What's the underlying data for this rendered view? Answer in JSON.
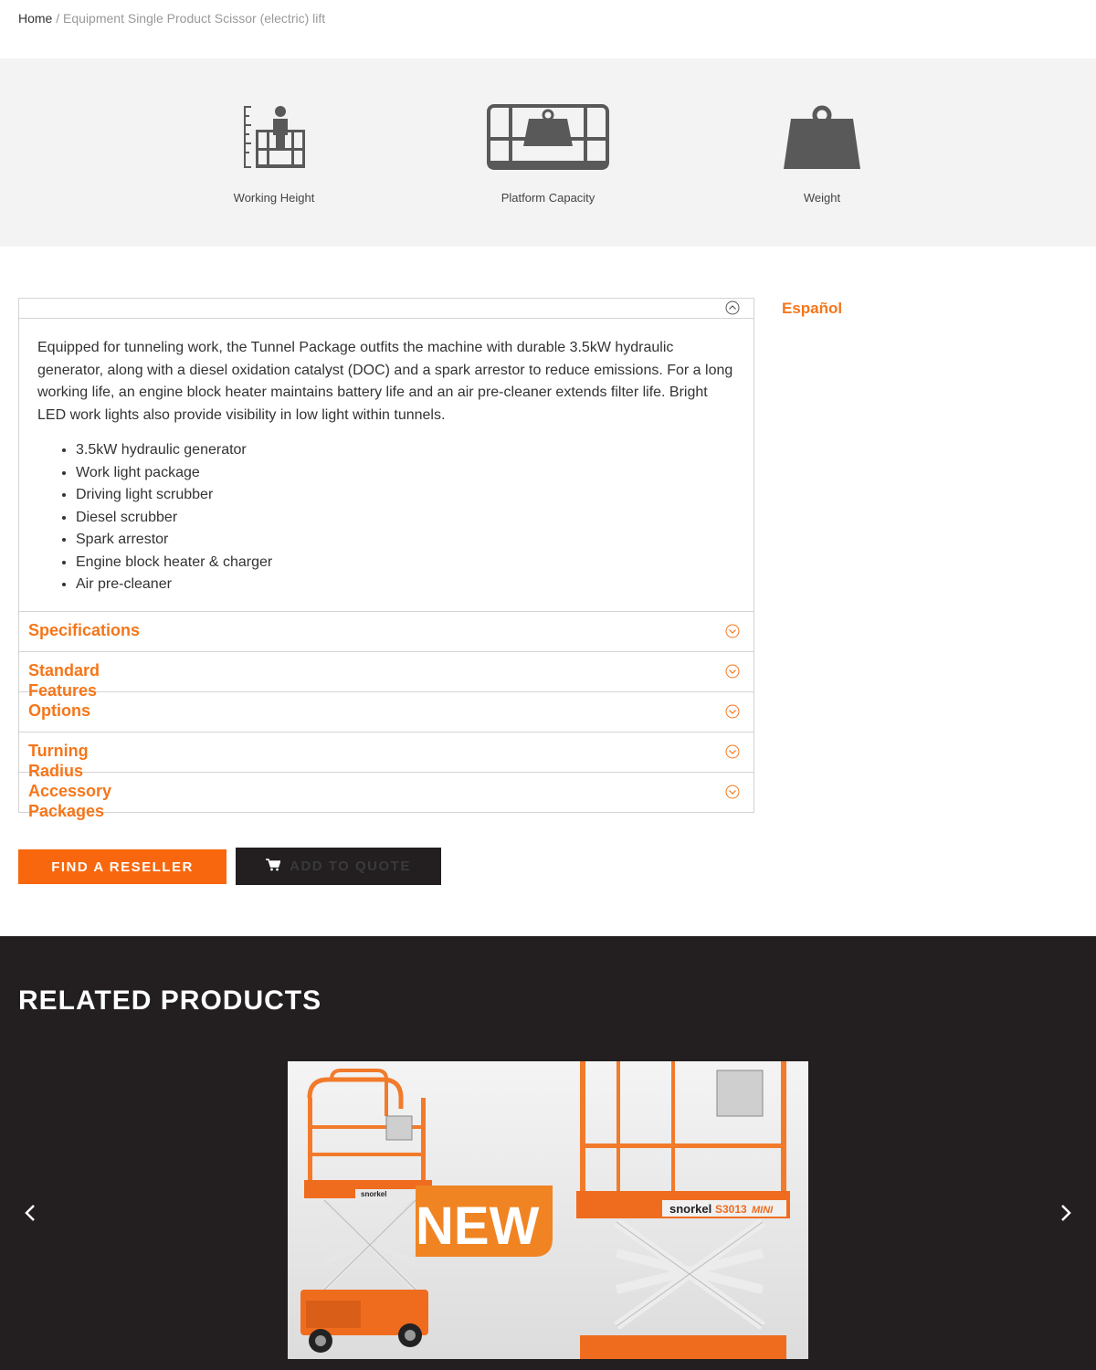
{
  "breadcrumb": {
    "home": "Home",
    "separator": "/",
    "trail": "Equipment Single Product Scissor (electric) lift"
  },
  "stats": [
    {
      "label": "Working Height",
      "icon": "working-height-icon"
    },
    {
      "label": "Platform Capacity",
      "icon": "platform-capacity-icon"
    },
    {
      "label": "Weight",
      "icon": "weight-icon"
    }
  ],
  "accordion": {
    "open_section": {
      "description": "Equipped for tunneling work, the Tunnel Package outfits the machine with durable 3.5kW hydraulic generator, along with a diesel oxidation catalyst (DOC) and a spark arrestor to reduce emissions. For a long working life, an engine block heater maintains battery life and an air pre-cleaner extends filter life. Bright LED work lights also provide visibility in low light within tunnels.",
      "features": [
        "3.5kW hydraulic generator",
        "Work light package",
        "Driving light scrubber",
        "Diesel scrubber",
        "Spark arrestor",
        "Engine block heater & charger",
        "Air pre-cleaner"
      ]
    },
    "sections": [
      "Specifications",
      "Standard Features",
      "Options",
      "Turning Radius",
      "Accessory Packages"
    ]
  },
  "language_link": "Español",
  "buttons": {
    "find_reseller": "FIND A RESELLER",
    "add_to_quote": "ADD TO QUOTE"
  },
  "related": {
    "heading": "RELATED PRODUCTS",
    "product_badge": "NEW",
    "product_brand": "snorkel",
    "product_model": "S3013",
    "product_variant": "MINI"
  },
  "colors": {
    "accent": "#f5761a",
    "dark": "#231f20",
    "stats_bg": "#f3f3f3",
    "icon_gray": "#595959"
  }
}
